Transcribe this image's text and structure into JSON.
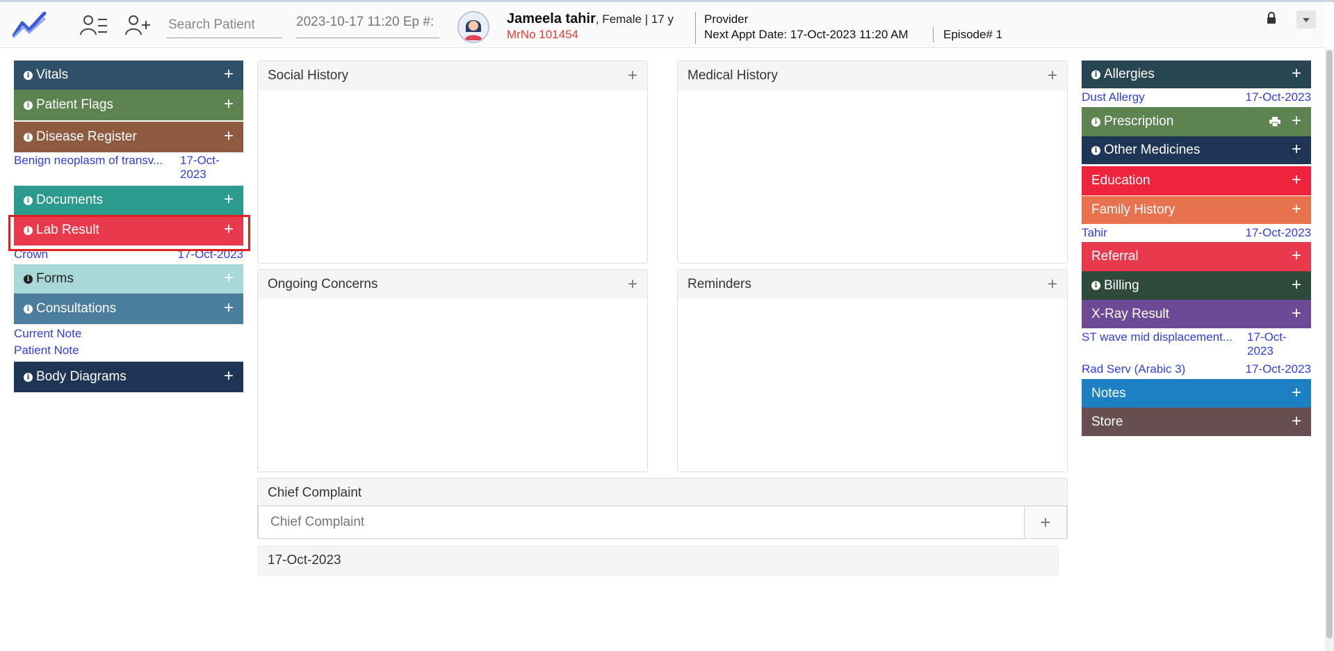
{
  "colors": {
    "vitals": "#2e5068",
    "patient_flags": "#5d8351",
    "disease_register": "#8e5a40",
    "documents": "#2a9b8c",
    "lab_result": "#e83a4c",
    "forms": "#a8d8d8",
    "consultations": "#4a7e9c",
    "body_diagrams": "#1e3555",
    "allergies": "#284552",
    "prescription": "#5d8351",
    "other_medicines": "#1e3555",
    "education": "#ef233c",
    "family_history": "#e8714e",
    "referral": "#e83a4c",
    "billing": "#2e4a3c",
    "xray": "#6d4a96",
    "notes": "#1d80c2",
    "store": "#674e50",
    "link": "#2f3de0",
    "highlight": "#e02020"
  },
  "header": {
    "search_placeholder": "Search Patient",
    "ep_date": "2023-10-17 11:20 Ep #:",
    "patient_name": "Jameela tahir",
    "patient_meta": ", Female | 17 y",
    "mrno": "MrNo 101454",
    "provider_label": "Provider",
    "next_appt": "Next Appt Date: 17-Oct-2023 11:20 AM",
    "episode": "Episode# 1",
    "icons": [
      "logo-icon",
      "patient-list-icon",
      "add-patient-icon",
      "avatar",
      "lock-icon",
      "dropdown-icon"
    ]
  },
  "left": {
    "vitals": "Vitals",
    "patient_flags": "Patient Flags",
    "disease_register": "Disease Register",
    "disease_item_name": "Benign neoplasm of transv...",
    "disease_item_date_1": "17-Oct-",
    "disease_item_date_2": "2023",
    "documents": "Documents",
    "lab_result": "Lab Result",
    "lab_item_name": "Crown",
    "lab_item_date": "17-Oct-2023",
    "forms": "Forms",
    "consultations": "Consultations",
    "consult_link_1": "Current Note",
    "consult_link_2": "Patient Note",
    "body_diagrams": "Body Diagrams"
  },
  "center": {
    "social_history": "Social History",
    "medical_history": "Medical History",
    "ongoing_concerns": "Ongoing Concerns",
    "reminders": "Reminders",
    "chief_complaint_title": "Chief Complaint",
    "chief_complaint_placeholder": "Chief Complaint",
    "date_entry": "17-Oct-2023"
  },
  "right": {
    "allergies": "Allergies",
    "allergy_item_name": "Dust Allergy",
    "allergy_item_date": "17-Oct-2023",
    "prescription": "Prescription",
    "other_medicines": "Other Medicines",
    "education": "Education",
    "family_history": "Family History",
    "family_item_name": "Tahir",
    "family_item_date": "17-Oct-2023",
    "referral": "Referral",
    "billing": "Billing",
    "xray": "X-Ray Result",
    "xray_item1_name": "ST wave mid displacement...",
    "xray_item1_date_1": "17-Oct-",
    "xray_item1_date_2": "2023",
    "xray_item2_name": "Rad Serv (Arabic 3)",
    "xray_item2_date": "17-Oct-2023",
    "notes": "Notes",
    "store": "Store"
  }
}
